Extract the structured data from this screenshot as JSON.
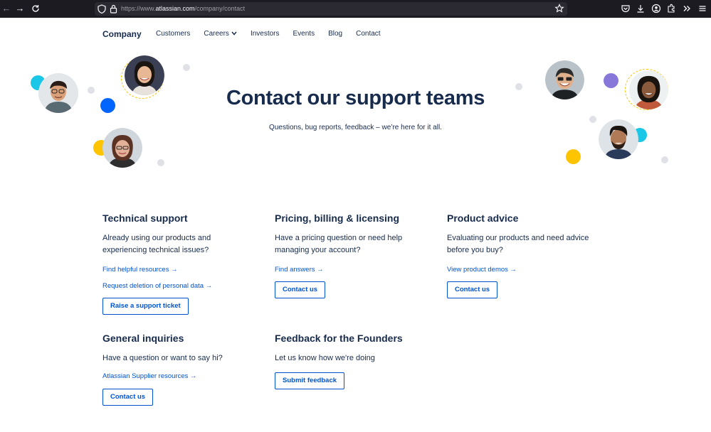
{
  "browser": {
    "url_prefix": "https://www.",
    "url_domain": "atlassian.com",
    "url_path": "/company/contact"
  },
  "nav": {
    "brand": "Company",
    "links": [
      "Customers",
      "Careers",
      "Investors",
      "Events",
      "Blog",
      "Contact"
    ]
  },
  "hero": {
    "title": "Contact our support teams",
    "subtitle": "Questions, bug reports, feedback – we’re here for it all."
  },
  "cards": {
    "technical": {
      "title": "Technical support",
      "desc": "Already using our products and experiencing technical issues?",
      "links": [
        "Find helpful resources →",
        "Request deletion of personal data →"
      ],
      "button": "Raise a support ticket"
    },
    "pricing": {
      "title": "Pricing, billing & licensing",
      "desc": "Have a pricing question or need help managing your account?",
      "links": [
        "Find answers →"
      ],
      "button": "Contact us"
    },
    "product": {
      "title": "Product advice",
      "desc": "Evaluating our products and need advice before you buy?",
      "links": [
        "View product demos →"
      ],
      "button": "Contact us"
    },
    "general": {
      "title": "General inquiries",
      "desc": "Have a question or want to say hi?",
      "links": [
        "Atlassian Supplier resources →"
      ],
      "button": "Contact us"
    },
    "feedback": {
      "title": "Feedback for the Founders",
      "desc": "Let us know how we're doing",
      "button": "Submit feedback"
    }
  },
  "colors": {
    "text": "#172b4d",
    "link": "#0052cc",
    "cyan": "#1ac7e6",
    "blue": "#0065ff",
    "yellow": "#ffc400",
    "purple": "#8777d9",
    "gray_dot": "#dfe1e6"
  },
  "icons": [
    "back-arrow-icon",
    "forward-arrow-icon",
    "reload-icon",
    "shield-icon",
    "lock-icon",
    "star-icon",
    "pocket-icon",
    "download-icon",
    "account-icon",
    "extensions-icon",
    "overflow-icon",
    "menu-icon",
    "chevron-down-icon"
  ]
}
